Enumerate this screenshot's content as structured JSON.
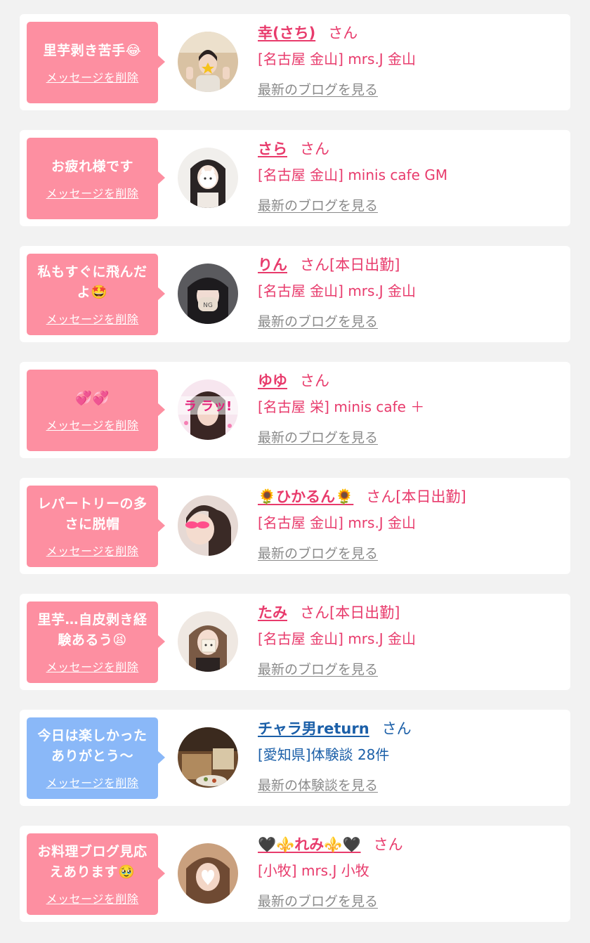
{
  "colors": {
    "bubble_pink": "#fd8fa1",
    "bubble_blue": "#8ab8f8",
    "name_pink": "#e83b6c",
    "name_blue": "#1b5fa8",
    "link_gray": "#8a8a8a",
    "page_bg": "#f2f2f2"
  },
  "items": [
    {
      "message": "里芋剥き苦手😂",
      "delete_label": "メッセージを削除",
      "name": "幸(さち)",
      "suffix": "さん",
      "shop": "[名古屋 金山] mrs.J 金山",
      "link": "最新のブログを見る",
      "avatar": "photo-avatar",
      "theme": "pink"
    },
    {
      "message": "お疲れ様です",
      "delete_label": "メッセージを削除",
      "name": "さら",
      "suffix": "さん",
      "shop": "[名古屋 金山] minis cafe GM",
      "link": "最新のブログを見る",
      "avatar": "photo-avatar",
      "theme": "pink"
    },
    {
      "message": "私もすぐに飛んだよ🤩",
      "delete_label": "メッセージを削除",
      "name": "りん",
      "suffix": "さん[本日出勤]",
      "shop": "[名古屋 金山] mrs.J 金山",
      "link": "最新のブログを見る",
      "avatar": "photo-avatar",
      "theme": "pink"
    },
    {
      "message": "💞💞",
      "delete_label": "メッセージを削除",
      "name": "ゆゆ",
      "suffix": "さん",
      "shop": "[名古屋 栄] minis cafe ＋",
      "link": "最新のブログを見る",
      "avatar": "photo-avatar",
      "theme": "pink"
    },
    {
      "message": "レパートリーの多さに脱帽",
      "delete_label": "メッセージを削除",
      "name": "🌻ひかるん🌻",
      "suffix": "さん[本日出勤]",
      "shop": "[名古屋 金山] mrs.J 金山",
      "link": "最新のブログを見る",
      "avatar": "photo-avatar",
      "theme": "pink"
    },
    {
      "message": "里芋…自皮剥き経験あるう😫",
      "delete_label": "メッセージを削除",
      "name": "たみ",
      "suffix": "さん[本日出勤]",
      "shop": "[名古屋 金山] mrs.J 金山",
      "link": "最新のブログを見る",
      "avatar": "photo-avatar",
      "theme": "pink"
    },
    {
      "message": "今日は楽しかったありがとう〜",
      "delete_label": "メッセージを削除",
      "name": "チャラ男return",
      "suffix": "さん",
      "shop": "[愛知県]体験談 28件",
      "link": "最新の体験談を見る",
      "avatar": "photo-avatar",
      "theme": "blue"
    },
    {
      "message": "お料理ブログ見応えあります🥹",
      "delete_label": "メッセージを削除",
      "name": "🖤⚜️れみ⚜️🖤",
      "suffix": "さん",
      "shop": "[小牧] mrs.J 小牧",
      "link": "最新のブログを見る",
      "avatar": "photo-avatar",
      "theme": "pink"
    }
  ]
}
